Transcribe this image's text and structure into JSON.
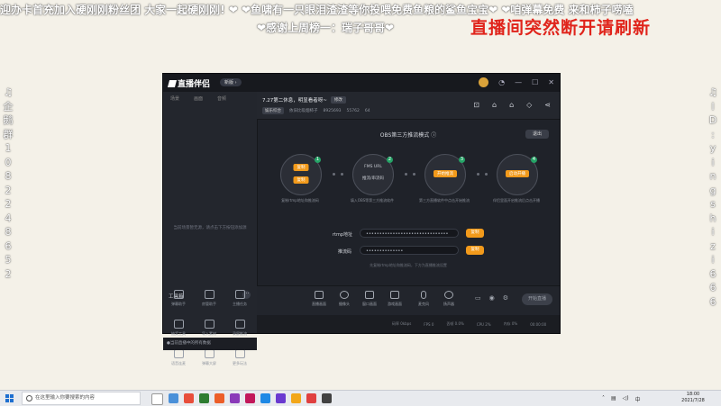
{
  "overlay": {
    "scroll_line1": "迎办卡首充加入硬刚刚粉丝团 大家一起硬刚刚! ❤ ❤鱼啸有一只眼泪渣渣等你投喂免费鱼粮的鲨鱼宝宝❤ ❤咱弹幕免费 来和柿子唠嗑",
    "scroll_line2": "❤感谢上周榜一：瑞子哥哥❤",
    "notice": "直播间突然断开请刷新",
    "left_vertical": "企鹅群1082248652",
    "left_icon": "♫",
    "right_vertical": "ID:yingshizi666",
    "right_icon": "♫"
  },
  "app": {
    "logo": "直播伴侣",
    "version_badge": "新版 ›",
    "titlebar_icons": [
      "avatar",
      "skin-icon",
      "minimize-icon",
      "maximize-icon",
      "close-icon"
    ],
    "sidebar": {
      "tabs": [
        "场景",
        "画面",
        "音频"
      ],
      "empty_text": "当前场景暂无源，请点击下方按钮添加源",
      "tools_header": "工具箱",
      "more_label": "···",
      "tools": [
        {
          "label": "弹幕助手",
          "icon": "danmu-icon"
        },
        {
          "label": "房管助手",
          "icon": "admin-icon"
        },
        {
          "label": "主播任务",
          "icon": "task-icon"
        },
        {
          "label": "抽奖工具",
          "icon": "lottery-icon"
        },
        {
          "label": "导入素材",
          "icon": "import-icon"
        },
        {
          "label": "录屏推流",
          "icon": "record-icon"
        },
        {
          "label": "语音连麦",
          "icon": "voice-icon"
        },
        {
          "label": "弹幕大屏",
          "icon": "screen-icon"
        },
        {
          "label": "更多玩法",
          "icon": "more-play-icon"
        },
        {
          "label": "NEW",
          "icon": "new-icon"
        },
        {
          "label": "",
          "icon": "gift-icon"
        },
        {
          "label": "",
          "icon": "store-icon"
        }
      ],
      "footer": "●当前直播中的所有数据"
    },
    "room": {
      "title": "7.27第二休息，明显看者呀~",
      "edit_btn": "修改",
      "category": "娱乐综合",
      "name": "依旧比吸烟柿子",
      "room_id": "8925693",
      "fans": "55762",
      "hot": "64",
      "header_icons": [
        "gift-icon",
        "lock-icon",
        "bell-icon",
        "bell2-icon",
        "share-icon"
      ]
    },
    "obs": {
      "title": "OBS第三方推流模式 ⓘ",
      "exit": "退出",
      "steps": [
        {
          "n": "1",
          "btn_a": "复制",
          "btn_b": "复制",
          "label_a": "",
          "caption": "复制rtmp地址和推流码"
        },
        {
          "n": "2",
          "btn_a": "",
          "btn_b": "",
          "label_a": "FMS URL",
          "label_b": "推流/串流码",
          "caption": "填入OBS等第三方推流软件"
        },
        {
          "n": "3",
          "btn_a": "开始推流",
          "btn_b": "",
          "label_a": "",
          "caption": "第三方直播软件中点击开始推流"
        },
        {
          "n": "4",
          "btn_a": "启动开播",
          "btn_b": "",
          "label_a": "",
          "caption": "伴侣里面开启推流后点击开播"
        }
      ],
      "rtmp_label": "rtmp地址",
      "rtmp_value": "•••••••••••••••••••••••••••••••",
      "key_label": "推流码",
      "key_value": "••••••••••••••",
      "copy": "复制",
      "hint": "先复制rtmp地址和推流码，下方为直播推流设置"
    },
    "bottom_tools": [
      {
        "label": "直播画面",
        "icon": "screen-icon"
      },
      {
        "label": "摄像头",
        "icon": "camera-icon"
      },
      {
        "label": "窗口画面",
        "icon": "window-icon"
      },
      {
        "label": "游戏画面",
        "icon": "game-icon"
      },
      {
        "label": "麦克风",
        "icon": "mic-icon"
      },
      {
        "label": "扬声器",
        "icon": "speaker-icon"
      }
    ],
    "start_live": "开始直播",
    "status_items": [
      "码率 0kbps",
      "FPS 0",
      "丢帧 0.0%",
      "CPU 2%",
      "内存 0%",
      "00:00:00"
    ]
  },
  "taskbar": {
    "search_placeholder": "在这里输入你要搜索的内容",
    "time": "18:00",
    "date": "2021/7/28",
    "app_colors": [
      "#ffffff",
      "#4a90d9",
      "#e84e3c",
      "#2e7d32",
      "#ec5e29",
      "#8a3ab9",
      "#c2185b",
      "#1e88e5",
      "#6a3ad0",
      "#f2a71b",
      "#e04040",
      "#424242"
    ]
  }
}
